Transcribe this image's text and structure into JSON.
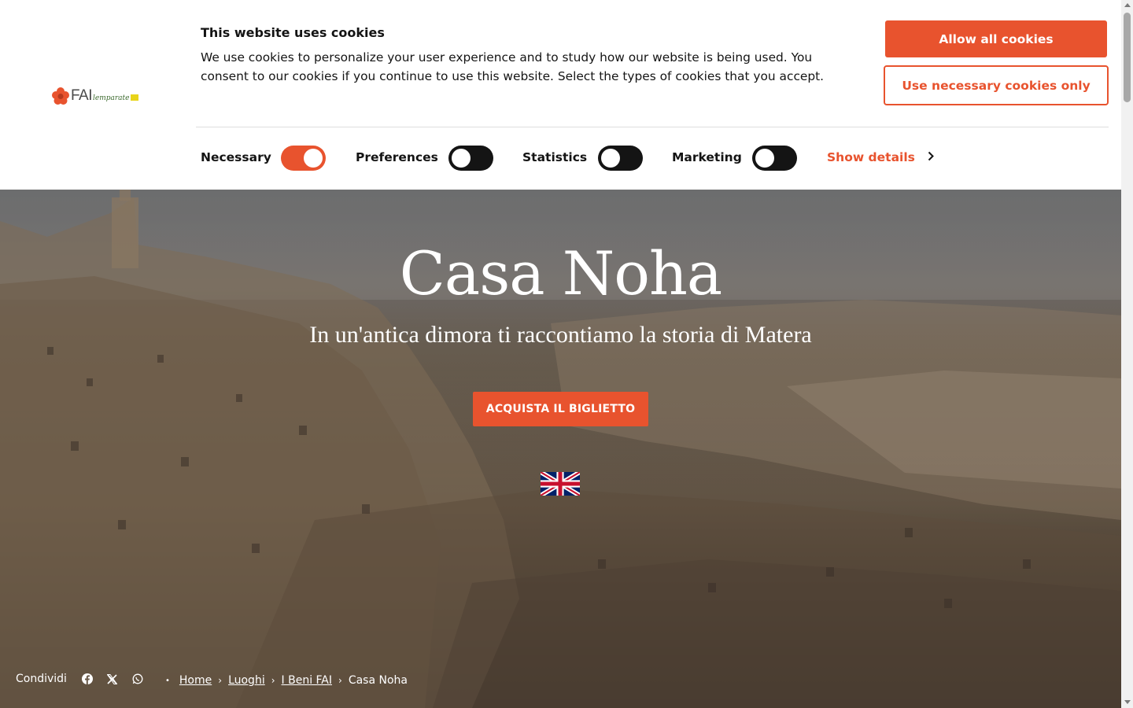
{
  "cookie_banner": {
    "title": "This website uses cookies",
    "text": "We use cookies to personalize your user experience and to study how our website is being used. You consent to our cookies if you continue to use this website. Select the types of cookies that you accept.",
    "allow_all_label": "Allow all cookies",
    "necessary_only_label": "Use necessary cookies only",
    "toggles": [
      {
        "label": "Necessary",
        "on": true
      },
      {
        "label": "Preferences",
        "on": false
      },
      {
        "label": "Statistics",
        "on": false
      },
      {
        "label": "Marketing",
        "on": false
      }
    ],
    "show_details_label": "Show details"
  },
  "logo": {
    "text": "FAI",
    "script": "lemparate",
    "icon": "flower-logo-icon"
  },
  "hero": {
    "title": "Casa Noha",
    "subtitle": "In un'antica dimora ti raccontiamo la storia di Matera",
    "ticket_button_label": "ACQUISTA IL BIGLIETTO",
    "language_icon": "uk-flag-icon"
  },
  "share": {
    "label": "Condividi",
    "icons": [
      "facebook-icon",
      "x-twitter-icon",
      "whatsapp-icon"
    ]
  },
  "breadcrumb": {
    "items": [
      "Home",
      "Luoghi",
      "I Beni FAI"
    ],
    "current": "Casa Noha"
  },
  "colors": {
    "accent": "#e8532e",
    "text": "#141414",
    "toggle_off": "#141414"
  }
}
